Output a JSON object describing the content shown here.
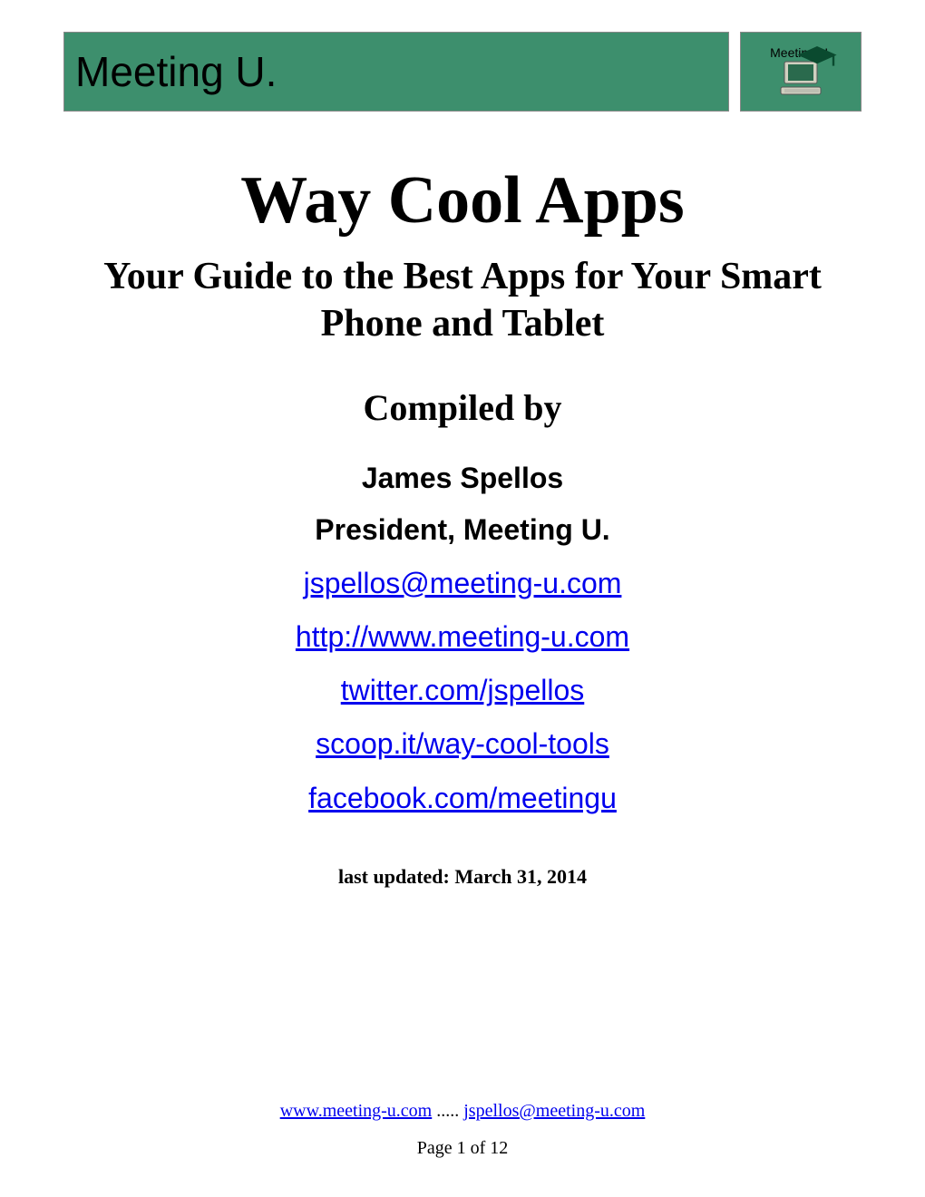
{
  "banner": {
    "left_text": "Meeting U.",
    "right_text": "Meeting U."
  },
  "title": "Way Cool Apps",
  "subtitle": "Your Guide to the Best Apps for Your Smart Phone and Tablet",
  "compiled_by_label": "Compiled by",
  "author_name": "James Spellos",
  "author_title": "President, Meeting U.",
  "links": {
    "email": "jspellos@meeting-u.com",
    "website": "http://www.meeting-u.com",
    "twitter": "twitter.com/jspellos",
    "scoopit": "scoop.it/way-cool-tools",
    "facebook": "facebook.com/meetingu"
  },
  "last_updated": "last updated: March 31, 2014",
  "footer": {
    "website": "www.meeting-u.com",
    "separator": ".....",
    "email": "jspellos@meeting-u.com",
    "page_label": "Page 1 of 12"
  }
}
